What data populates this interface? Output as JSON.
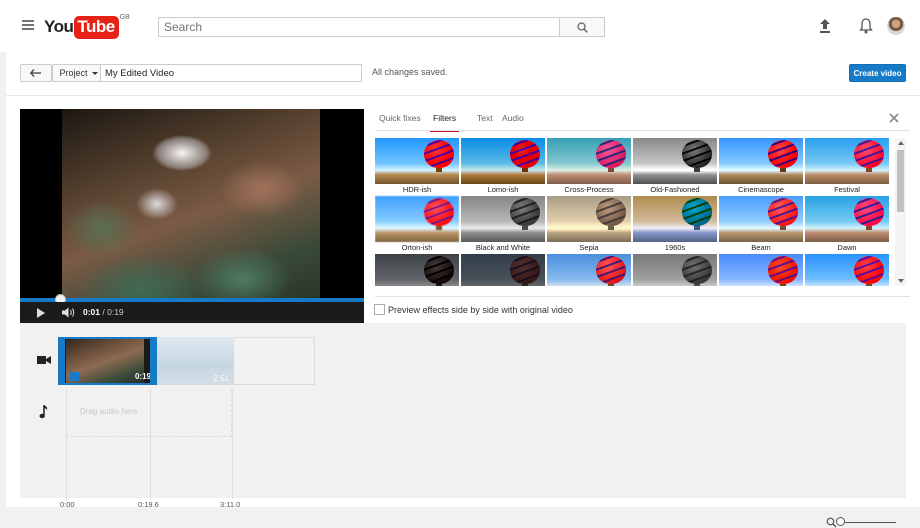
{
  "masthead": {
    "logo_you": "You",
    "logo_tube": "Tube",
    "logo_region": "GB",
    "search_placeholder": "Search",
    "icons": [
      "hamburger-menu-icon",
      "search-icon",
      "upload-icon",
      "notification-bell-icon",
      "avatar"
    ]
  },
  "editor": {
    "project_label": "Project",
    "title_value": "My Edited Video",
    "save_status": "All changes saved.",
    "create_label": "Create video",
    "accent_color": "#167ac6"
  },
  "player": {
    "current_time": "0:01",
    "separator": " / ",
    "total_time": "0:19",
    "progress": 0.1
  },
  "effects": {
    "tabs": [
      {
        "label": "Quick fixes",
        "active": false
      },
      {
        "label": "Filters",
        "active": true
      },
      {
        "label": "Text",
        "active": false
      },
      {
        "label": "Audio",
        "active": false
      }
    ],
    "active_tab_color": "#cc181e",
    "filters": [
      "HDR-ish",
      "Lomo-ish",
      "Cross-Process",
      "Old-Fashioned",
      "Cinemascope",
      "Festival",
      "Orton-ish",
      "Black and White",
      "Sepia",
      "1960s",
      "Beam",
      "Dawn",
      "",
      "",
      "",
      "",
      "",
      ""
    ],
    "preview_label": "Preview effects side by side with original video",
    "preview_checked": false
  },
  "timeline": {
    "clip_duration": "0:19",
    "ghost_duration": "2:51",
    "audio_placeholder": "Drag audio here",
    "ruler": [
      "0:00",
      "0:19.6",
      "3:11.0"
    ]
  }
}
